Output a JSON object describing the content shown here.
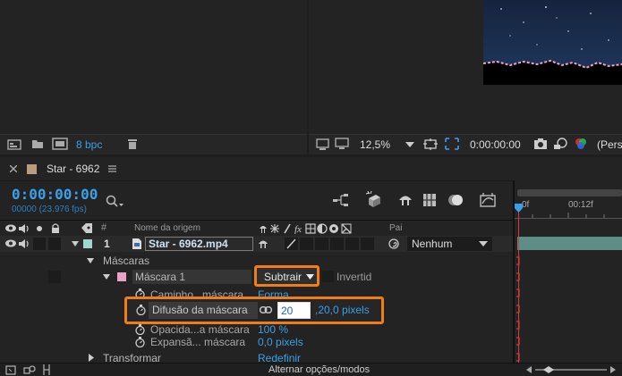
{
  "project_panel": {
    "bit_depth": "8 bpc"
  },
  "viewer": {
    "zoom": "12,5%",
    "timecode": "0:00:00:00",
    "view_label": "(Pers"
  },
  "timeline": {
    "tab_title": "Star - 6962",
    "timecode": "0:00:00:00",
    "fps_line": "00000 (23.976 fps)",
    "search_placeholder": "",
    "ruler": {
      "start": "0f",
      "mark": "00:12f"
    },
    "columns": {
      "hash": "#",
      "source_name": "Nome da origem",
      "pai": "Pai"
    },
    "layer": {
      "number": "1",
      "name": "Star - 6962.mp4",
      "parent": "Nenhum"
    },
    "masks_group": "Máscaras",
    "mask": {
      "name": "Máscara 1",
      "mode": "Subtrair",
      "inverted": "Invertid"
    },
    "properties": [
      {
        "name": "Caminho...máscara",
        "value": "Forma..."
      },
      {
        "name": "Difusão da máscara",
        "value_input": "20",
        "value_rest": ",20,0 pixels"
      },
      {
        "name": "Opacida...a máscara",
        "value": "100 %"
      },
      {
        "name": "Expansã... máscara",
        "value": "0,0 pixels"
      }
    ],
    "transform": {
      "name": "Transformar",
      "action": "Redefinir"
    },
    "footer": {
      "toggle": "Alternar opções/modos"
    }
  },
  "colors": {
    "accent_blue": "#3aa0e8",
    "highlight_orange": "#f07d16",
    "playhead": "#d03a3a"
  }
}
